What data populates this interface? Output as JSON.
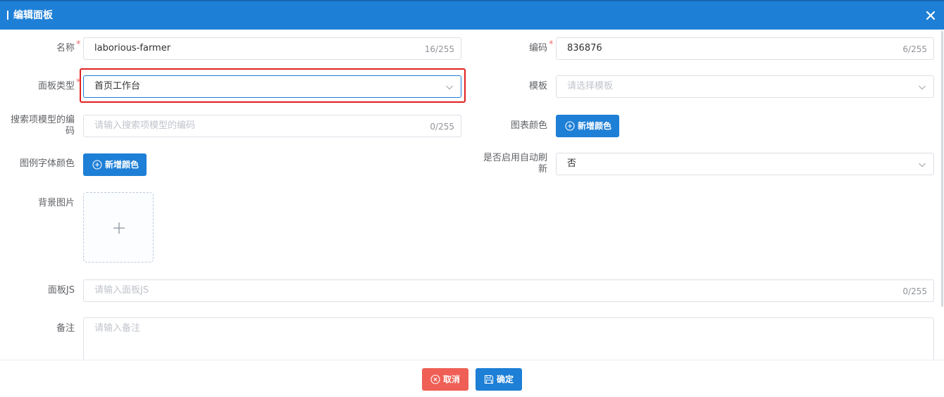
{
  "dialog": {
    "title": "编辑面板",
    "close_icon": "close-icon"
  },
  "fields": {
    "name": {
      "label": "名称",
      "required_mark": "*",
      "value": "laborious-farmer",
      "counter": "16/255"
    },
    "code": {
      "label": "编码",
      "required_mark": "*",
      "value": "836876",
      "counter": "6/255"
    },
    "panel_type": {
      "label": "面板类型",
      "required_mark": "*",
      "value": "首页工作台"
    },
    "template": {
      "label": "模板",
      "placeholder": "请选择模板"
    },
    "search_model_code": {
      "label_line1": "搜索项模型的编",
      "label_line2": "码",
      "placeholder": "请输入搜索项模型的编码",
      "counter": "0/255"
    },
    "chart_color": {
      "label": "图表颜色",
      "button_label": "新增颜色"
    },
    "legend_font_color": {
      "label": "图例字体颜色",
      "button_label": "新增颜色"
    },
    "auto_refresh": {
      "label_line1": "是否启用自动刷",
      "label_line2": "新",
      "value": "否"
    },
    "background_image": {
      "label": "背景图片"
    },
    "panel_js": {
      "label": "面板JS",
      "placeholder": "请输入面板JS",
      "counter": "0/255"
    },
    "remark": {
      "label": "备注",
      "placeholder": "请输入备注"
    }
  },
  "footer": {
    "cancel_label": "取消",
    "confirm_label": "确定"
  },
  "colors": {
    "primary": "#1e7fd6",
    "danger": "#ef5f55",
    "required": "#f56c6c",
    "highlight": "#e02020"
  }
}
